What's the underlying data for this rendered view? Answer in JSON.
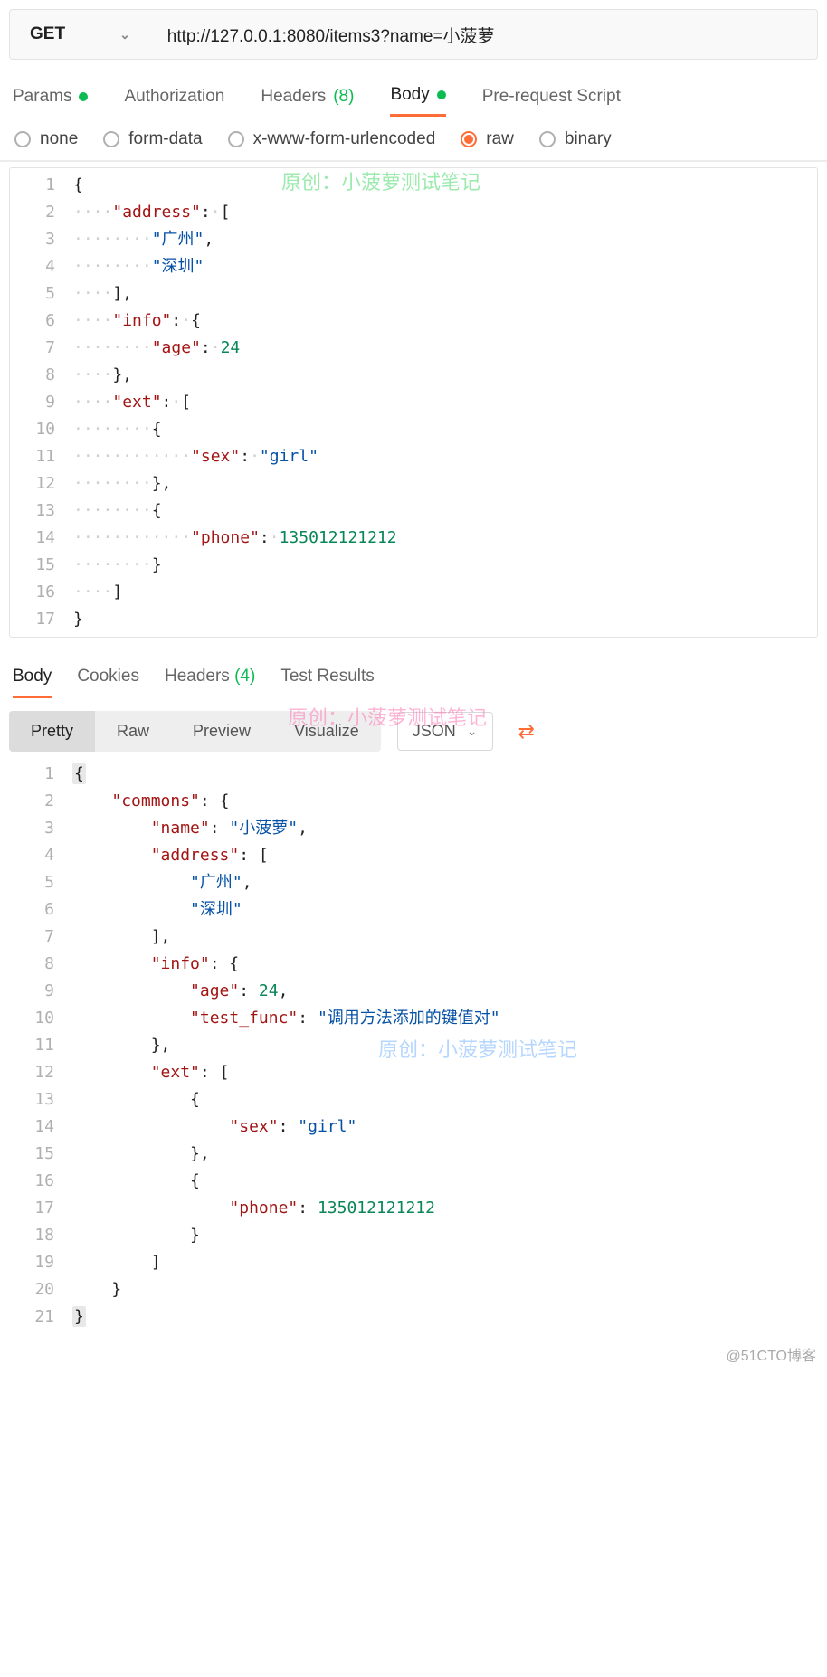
{
  "request": {
    "method": "GET",
    "url": "http://127.0.0.1:8080/items3?name=小菠萝"
  },
  "reqTabs": {
    "params": "Params",
    "authorization": "Authorization",
    "headers": "Headers",
    "headersCount": "(8)",
    "body": "Body",
    "prerequest": "Pre-request Script"
  },
  "bodyTypes": {
    "none": "none",
    "formdata": "form-data",
    "urlencoded": "x-www-form-urlencoded",
    "raw": "raw",
    "binary": "binary"
  },
  "reqBody": {
    "l1": "{",
    "l2_key": "\"address\"",
    "l2_rest": ": [",
    "l3": "\"广州\"",
    "l4": "\"深圳\"",
    "l5": "],",
    "l6_key": "\"info\"",
    "l6_rest": ": {",
    "l7_key": "\"age\"",
    "l7_val": "24",
    "l8": "},",
    "l9_key": "\"ext\"",
    "l9_rest": ": [",
    "l10": "{",
    "l11_key": "\"sex\"",
    "l11_val": "\"girl\"",
    "l12": "},",
    "l13": "{",
    "l14_key": "\"phone\"",
    "l14_val": "135012121212",
    "l15": "}",
    "l16": "]",
    "l17": "}"
  },
  "lineNums": {
    "n1": "1",
    "n2": "2",
    "n3": "3",
    "n4": "4",
    "n5": "5",
    "n6": "6",
    "n7": "7",
    "n8": "8",
    "n9": "9",
    "n10": "10",
    "n11": "11",
    "n12": "12",
    "n13": "13",
    "n14": "14",
    "n15": "15",
    "n16": "16",
    "n17": "17",
    "n18": "18",
    "n19": "19",
    "n20": "20",
    "n21": "21"
  },
  "watermarks": {
    "wm1": "原创：小菠萝测试笔记",
    "wm2": "原创：小菠萝测试笔记",
    "wm3": "原创：小菠萝测试笔记",
    "footer": "@51CTO博客"
  },
  "respTabs": {
    "body": "Body",
    "cookies": "Cookies",
    "headers": "Headers",
    "headersCount": "(4)",
    "testResults": "Test Results"
  },
  "viewBtns": {
    "pretty": "Pretty",
    "raw": "Raw",
    "preview": "Preview",
    "visualize": "Visualize",
    "json": "JSON"
  },
  "respBody": {
    "l1": "{",
    "l2_key": "\"commons\"",
    "l2_rest": ": {",
    "l3_key": "\"name\"",
    "l3_val": "\"小菠萝\"",
    "l4_key": "\"address\"",
    "l4_rest": ": [",
    "l5": "\"广州\"",
    "l6": "\"深圳\"",
    "l7": "],",
    "l8_key": "\"info\"",
    "l8_rest": ": {",
    "l9_key": "\"age\"",
    "l9_val": "24",
    "l10_key": "\"test_func\"",
    "l10_val": "\"调用方法添加的键值对\"",
    "l11": "},",
    "l12_key": "\"ext\"",
    "l12_rest": ": [",
    "l13": "{",
    "l14_key": "\"sex\"",
    "l14_val": "\"girl\"",
    "l15": "},",
    "l16": "{",
    "l17_key": "\"phone\"",
    "l17_val": "135012121212",
    "l18": "}",
    "l19": "]",
    "l20": "}",
    "l21": "}"
  }
}
